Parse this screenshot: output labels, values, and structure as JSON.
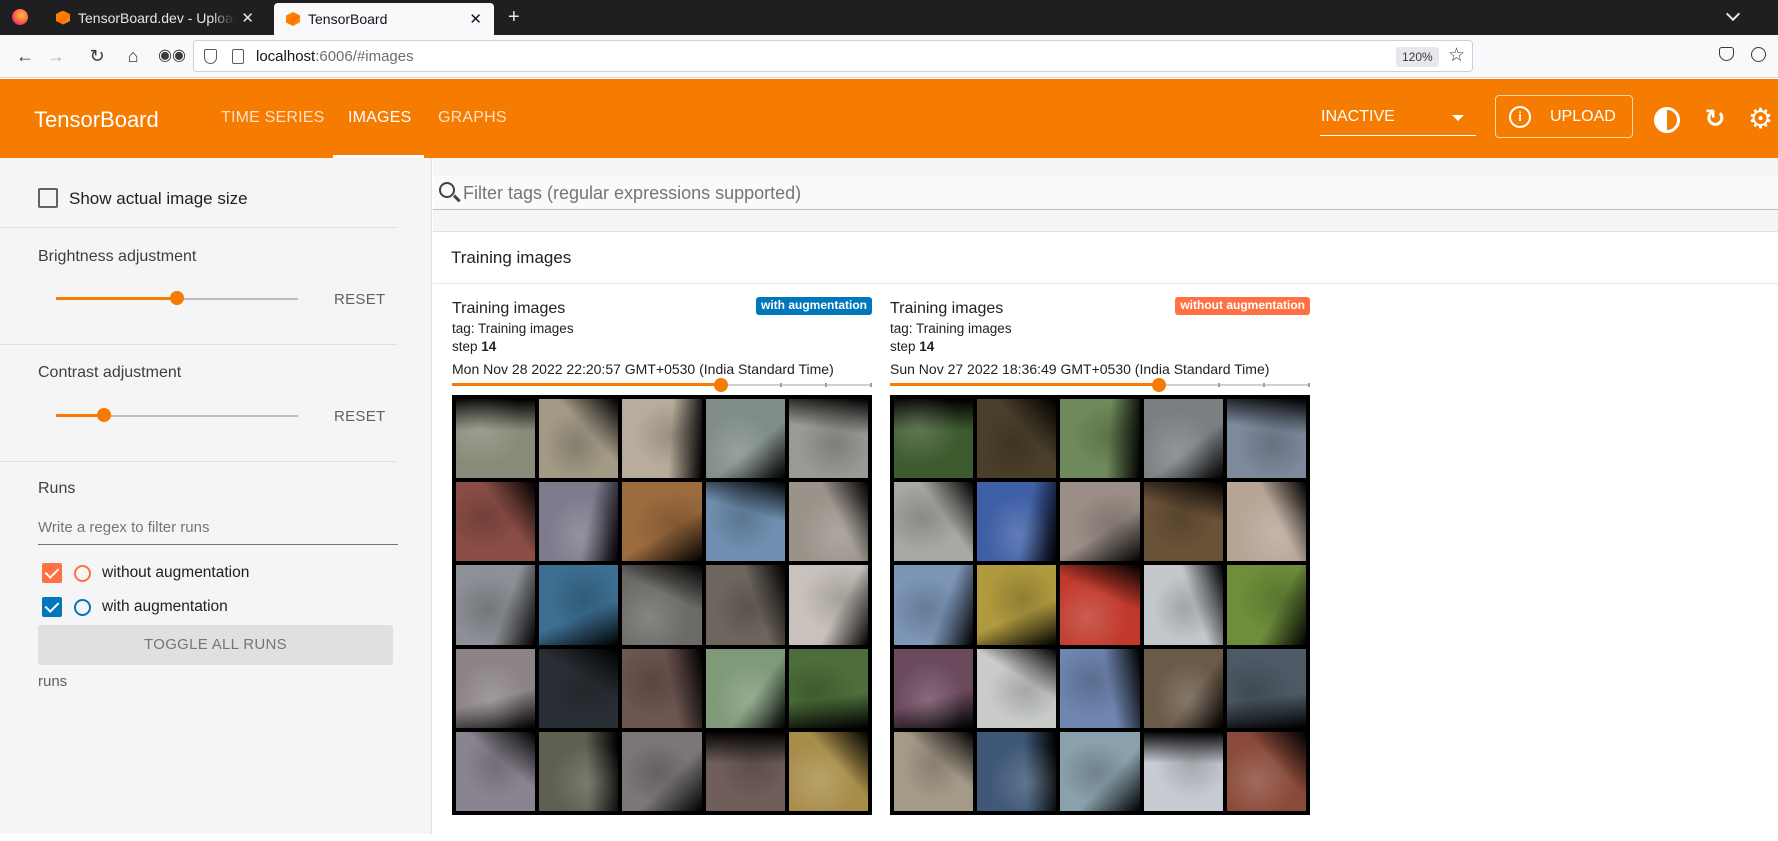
{
  "browser": {
    "tabs": [
      {
        "title": "TensorBoard.dev - Upload",
        "active": false
      },
      {
        "title": "TensorBoard",
        "active": true
      }
    ],
    "url_host": "localhost",
    "url_rest": ":6006/#images",
    "zoom": "120%"
  },
  "header": {
    "brand": "TensorBoard",
    "tabs": [
      "TIME SERIES",
      "IMAGES",
      "GRAPHS"
    ],
    "active_tab": "IMAGES",
    "reload_state": "INACTIVE",
    "upload_label": "UPLOAD",
    "accent_color": "#f57c00"
  },
  "sidebar": {
    "show_actual_size_label": "Show actual image size",
    "show_actual_size_checked": false,
    "brightness_label": "Brightness adjustment",
    "brightness_level": 0.5,
    "contrast_label": "Contrast adjustment",
    "contrast_level": 0.2,
    "reset_label": "RESET",
    "runs_title": "Runs",
    "runs_filter_placeholder": "Write a regex to filter runs",
    "runs": [
      {
        "name": "without augmentation",
        "checked": true,
        "color": "#ff7043"
      },
      {
        "name": "with augmentation",
        "checked": true,
        "color": "#0077bb"
      }
    ],
    "toggle_all_label": "TOGGLE ALL RUNS",
    "runs_footer": "runs"
  },
  "main": {
    "filter_placeholder": "Filter tags (regular expressions supported)",
    "card_title": "Training images",
    "panels": [
      {
        "title": "Training images",
        "run": "with augmentation",
        "run_color": "#0077bb",
        "tag": "tag: Training images",
        "step_label": "step",
        "step": "14",
        "timestamp": "Mon Nov 28 2022 22:20:57 GMT+0530 (India Standard Time)",
        "step_position": 0.64
      },
      {
        "title": "Training images",
        "run": "without augmentation",
        "run_color": "#ff7043",
        "tag": "tag: Training images",
        "step_label": "step",
        "step": "14",
        "timestamp": "Sun Nov 27 2022 18:36:49 GMT+0530 (India Standard Time)",
        "step_position": 0.64
      }
    ]
  }
}
